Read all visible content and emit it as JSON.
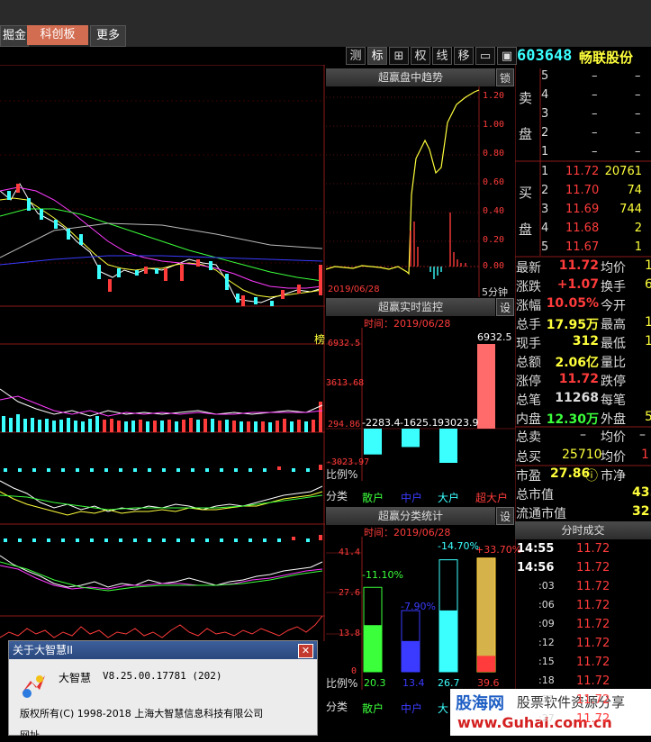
{
  "tabs": [
    {
      "label": "掘金"
    },
    {
      "label": "科创板"
    },
    {
      "label": "更多"
    }
  ],
  "toolbar_buttons": [
    "测",
    "标",
    "⊞",
    "权",
    "线",
    "移",
    "▭",
    "▣"
  ],
  "stock": {
    "code": "603648",
    "name": "畅联股份"
  },
  "left_label": "榜",
  "intraday": {
    "title": "超赢盘中趋势",
    "lock_label": "锁",
    "date": "2019/06/28",
    "interval": "5分钟",
    "y_ticks": [
      "1.20",
      "1.00",
      "0.80",
      "0.60",
      "0.40",
      "0.20",
      "0.00"
    ]
  },
  "monitor": {
    "title": "超赢实时监控",
    "set_label": "设",
    "time_label": "时间：2019/06/28",
    "y_ticks": [
      "6932.5",
      "3613.68",
      "294.86",
      "-3023.97"
    ],
    "values": [
      {
        "category": "散户",
        "value": -2283.4
      },
      {
        "category": "中户",
        "value": -1625.1
      },
      {
        "category": "大户",
        "value": -3023.9
      },
      {
        "category": "超大户",
        "value": 6932.5
      }
    ],
    "value_labels": [
      "-2283.4",
      "-1625.1",
      "93023.9",
      "6932.5"
    ],
    "ratio_label": "比例%",
    "class_label": "分类",
    "categories": [
      "散户",
      "中户",
      "大户",
      "超大户"
    ]
  },
  "classify": {
    "title": "超赢分类统计",
    "set_label": "设",
    "time_label": "时间：2019/06/28",
    "y_ticks": [
      "41.4",
      "27.6",
      "13.8",
      "0"
    ],
    "pct_labels": [
      "-11.10%",
      "-7.90%",
      "-14.70%",
      "+33.70%"
    ],
    "bottom_values": [
      "20.3",
      "13.4",
      "26.7",
      "39.6"
    ],
    "ratio_label": "比例%",
    "class_label": "分类",
    "categories": [
      "散户",
      "中户",
      "大"
    ]
  },
  "ask": [
    {
      "level": "5",
      "price": "–",
      "vol": "–"
    },
    {
      "level": "4",
      "price": "–",
      "vol": "–"
    },
    {
      "level": "3",
      "price": "–",
      "vol": "–"
    },
    {
      "level": "2",
      "price": "–",
      "vol": "–"
    },
    {
      "level": "1",
      "price": "–",
      "vol": "–"
    }
  ],
  "ask_label": [
    "卖",
    "盘"
  ],
  "bid_label": [
    "买",
    "",
    "盘"
  ],
  "bid": [
    {
      "level": "1",
      "price": "11.72",
      "vol": "20761"
    },
    {
      "level": "2",
      "price": "11.70",
      "vol": "74"
    },
    {
      "level": "3",
      "price": "11.69",
      "vol": "744"
    },
    {
      "level": "4",
      "price": "11.68",
      "vol": "2"
    },
    {
      "level": "5",
      "price": "11.67",
      "vol": "1"
    }
  ],
  "stats": [
    {
      "k1": "最新",
      "v1": "11.72",
      "k2": "均价",
      "v2": "1"
    },
    {
      "k1": "涨跌",
      "v1": "+1.07",
      "k2": "换手",
      "v2": "6"
    },
    {
      "k1": "涨幅",
      "v1": "10.05%",
      "k2": "今开",
      "v2": ""
    },
    {
      "k1": "总手",
      "v1": "17.95万",
      "k2": "最高",
      "v2": "1"
    },
    {
      "k1": "现手",
      "v1": "312",
      "k2": "最低",
      "v2": "1"
    },
    {
      "k1": "总额",
      "v1": "2.06亿",
      "k2": "量比",
      "v2": ""
    },
    {
      "k1": "涨停",
      "v1": "11.72",
      "k2": "跌停",
      "v2": ""
    },
    {
      "k1": "总笔",
      "v1": "11268",
      "k2": "每笔",
      "v2": ""
    },
    {
      "k1": "内盘",
      "v1": "12.30万",
      "k2": "外盘",
      "v2": "5"
    }
  ],
  "sell_total": {
    "k1": "总卖",
    "v1": "–",
    "k2": "均价",
    "v2": "–"
  },
  "buy_total": {
    "k1": "总买",
    "v1": "25710",
    "k2": "均价",
    "v2": "1"
  },
  "pe": {
    "k1": "市盈",
    "v1": "27.86",
    "k2": "市净",
    "v2": ""
  },
  "mcap": {
    "k": "总市值",
    "v": "43."
  },
  "float_mcap": {
    "k": "流通市值",
    "v": "32."
  },
  "trades_title": "分时成交",
  "trades": [
    {
      "time": "14:55",
      "price": "11.72"
    },
    {
      "time": "14:56",
      "price": "11.72"
    },
    {
      "time": ":03",
      "price": "11.72"
    },
    {
      "time": ":06",
      "price": "11.72"
    },
    {
      "time": ":09",
      "price": "11.72"
    },
    {
      "time": ":12",
      "price": "11.72"
    },
    {
      "time": ":15",
      "price": "11.72"
    },
    {
      "time": ":18",
      "price": "11.72"
    },
    {
      "time": ":21",
      "price": "11.72"
    },
    {
      "time": ":27",
      "price": "11.72"
    }
  ],
  "dialog": {
    "title": "关于大智慧II",
    "close": "✕",
    "app_name": "大智慧",
    "version": "V8.25.00.17781 (202)",
    "copyright": "版权所有(C) 1998-2018  上海大智慧信息科技有限公司",
    "extra": "网址"
  },
  "watermark": {
    "brand": "股海网",
    "slogan": "股票软件资源分享",
    "url": "www.Guhai.com.cn"
  },
  "colors": {
    "up": "#ff3b3b",
    "down": "#3bffff",
    "accent": "#d26d52",
    "yellow": "#ffff3b",
    "green": "#3bff3b"
  }
}
